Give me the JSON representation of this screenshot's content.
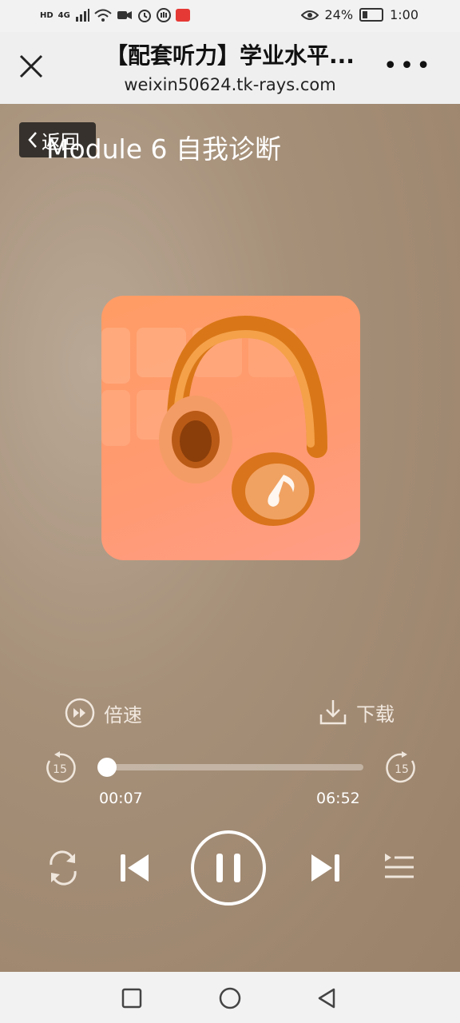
{
  "status_bar": {
    "hd": "HD",
    "network": "4G",
    "battery_percent": "24%",
    "time": "1:00"
  },
  "header": {
    "title": "【配套听力】学业水平...",
    "url": "weixin50624.tk-rays.com"
  },
  "player": {
    "back_label": "返回",
    "track_title": "Module 6 自我诊断",
    "speed_label": "倍速",
    "download_label": "下载",
    "skip_back_seconds": "15",
    "skip_forward_seconds": "15",
    "current_time": "00:07",
    "total_time": "06:52",
    "progress_fraction": 0.017
  },
  "icons": [
    "close-icon",
    "more-icon",
    "speed-icon",
    "download-icon",
    "rewind-15-icon",
    "forward-15-icon",
    "loop-icon",
    "previous-icon",
    "pause-icon",
    "next-icon",
    "playlist-icon",
    "square-nav-icon",
    "circle-nav-icon",
    "triangle-nav-icon"
  ],
  "colors": {
    "accent": "#ffffff",
    "cover": "#ff9c65",
    "background": "#a89078"
  }
}
